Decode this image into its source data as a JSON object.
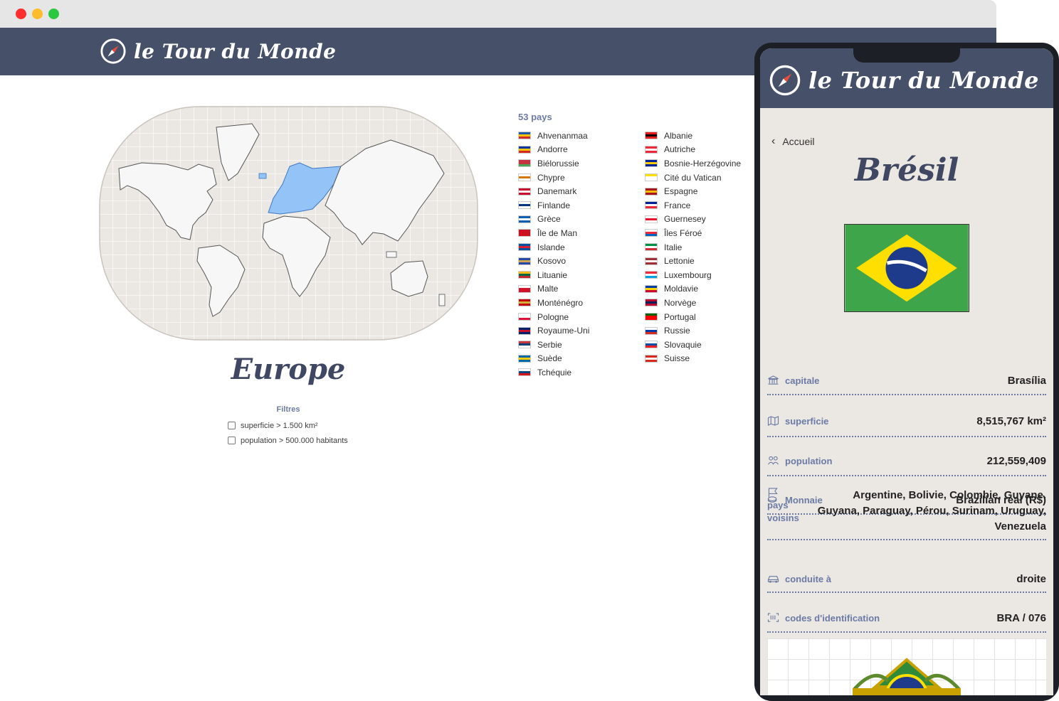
{
  "desktop": {
    "window_dots": [
      "#fe2e2e",
      "#fdbc2c",
      "#29c840"
    ],
    "logo_text": "le Tour du Monde",
    "region_title": "Europe",
    "filters": {
      "title": "Filtres",
      "items": [
        {
          "label": "superficie > 1.500 km²",
          "checked": false
        },
        {
          "label": "population > 500.000 habitants",
          "checked": false
        }
      ]
    },
    "country_count": "53 pays",
    "countries_left": [
      {
        "name": "Ahvenanmaa",
        "flag": [
          "#1f5aa6",
          "#f2c500",
          "#d12d2d"
        ]
      },
      {
        "name": "Andorre",
        "flag": [
          "#10379c",
          "#f2c500",
          "#d52b1e"
        ]
      },
      {
        "name": "Biélorussie",
        "flag": [
          "#c8313e",
          "#c8313e",
          "#4aa657"
        ]
      },
      {
        "name": "Chypre",
        "flag": [
          "#ffffff",
          "#d57800",
          "#ffffff"
        ]
      },
      {
        "name": "Danemark",
        "flag": [
          "#c8102e",
          "#ffffff",
          "#c8102e"
        ]
      },
      {
        "name": "Finlande",
        "flag": [
          "#ffffff",
          "#003580",
          "#ffffff"
        ]
      },
      {
        "name": "Grèce",
        "flag": [
          "#0d5eaf",
          "#ffffff",
          "#0d5eaf"
        ]
      },
      {
        "name": "Île de Man",
        "flag": [
          "#cf1020",
          "#cf1020",
          "#cf1020"
        ]
      },
      {
        "name": "Islande",
        "flag": [
          "#02529c",
          "#dc1e35",
          "#02529c"
        ]
      },
      {
        "name": "Kosovo",
        "flag": [
          "#244aa5",
          "#d0a650",
          "#244aa5"
        ]
      },
      {
        "name": "Lituanie",
        "flag": [
          "#fdb913",
          "#006a44",
          "#c1272d"
        ]
      },
      {
        "name": "Malte",
        "flag": [
          "#ffffff",
          "#cf142b",
          "#cf142b"
        ]
      },
      {
        "name": "Monténégro",
        "flag": [
          "#c40308",
          "#d4af3a",
          "#c40308"
        ]
      },
      {
        "name": "Pologne",
        "flag": [
          "#ffffff",
          "#ffffff",
          "#dc143c"
        ]
      },
      {
        "name": "Royaume-Uni",
        "flag": [
          "#012169",
          "#c8102e",
          "#012169"
        ]
      },
      {
        "name": "Serbie",
        "flag": [
          "#c6363c",
          "#0c4076",
          "#ffffff"
        ]
      },
      {
        "name": "Suède",
        "flag": [
          "#006aa7",
          "#fecc00",
          "#006aa7"
        ]
      },
      {
        "name": "Tchéquie",
        "flag": [
          "#ffffff",
          "#11457e",
          "#d7141a"
        ]
      }
    ],
    "countries_right": [
      {
        "name": "Albanie",
        "flag": [
          "#e41e20",
          "#000000",
          "#e41e20"
        ]
      },
      {
        "name": "Autriche",
        "flag": [
          "#ed2939",
          "#ffffff",
          "#ed2939"
        ]
      },
      {
        "name": "Bosnie-Herzégovine",
        "flag": [
          "#002395",
          "#fecb00",
          "#002395"
        ]
      },
      {
        "name": "Cité du Vatican",
        "flag": [
          "#ffe000",
          "#ffffff",
          "#ffffff"
        ]
      },
      {
        "name": "Espagne",
        "flag": [
          "#aa151b",
          "#f1bf00",
          "#aa151b"
        ]
      },
      {
        "name": "France",
        "flag": [
          "#002395",
          "#ffffff",
          "#ed2939"
        ]
      },
      {
        "name": "Guernesey",
        "flag": [
          "#ffffff",
          "#e8112d",
          "#ffffff"
        ]
      },
      {
        "name": "Îles Féroé",
        "flag": [
          "#ffffff",
          "#ed2939",
          "#0065bd"
        ]
      },
      {
        "name": "Italie",
        "flag": [
          "#009246",
          "#ffffff",
          "#ce2b37"
        ]
      },
      {
        "name": "Lettonie",
        "flag": [
          "#9e3039",
          "#ffffff",
          "#9e3039"
        ]
      },
      {
        "name": "Luxembourg",
        "flag": [
          "#ed2939",
          "#ffffff",
          "#00a1de"
        ]
      },
      {
        "name": "Moldavie",
        "flag": [
          "#003da5",
          "#ffd200",
          "#cc092f"
        ]
      },
      {
        "name": "Norvège",
        "flag": [
          "#ba0c2f",
          "#00205b",
          "#ba0c2f"
        ]
      },
      {
        "name": "Portugal",
        "flag": [
          "#006600",
          "#ff0000",
          "#ff0000"
        ]
      },
      {
        "name": "Russie",
        "flag": [
          "#ffffff",
          "#0039a6",
          "#d52b1e"
        ]
      },
      {
        "name": "Slovaquie",
        "flag": [
          "#ffffff",
          "#0b4ea2",
          "#ee1c25"
        ]
      },
      {
        "name": "Suisse",
        "flag": [
          "#d52b1e",
          "#ffffff",
          "#d52b1e"
        ]
      }
    ]
  },
  "mobile": {
    "logo_text": "le Tour du Monde",
    "back_label": "Accueil",
    "country_name": "Brésil",
    "facts": [
      {
        "icon": "museum-icon",
        "label": "capitale",
        "value": "Brasília"
      },
      {
        "icon": "map-icon",
        "label": "superficie",
        "value": "8,515,767 km²"
      },
      {
        "icon": "people-icon",
        "label": "population",
        "value": "212,559,409"
      },
      {
        "icon": "coins-icon",
        "label": "Monnaie",
        "value": "Brazilian real (R$)"
      },
      {
        "icon": "flag-icon",
        "label": "pays voisins",
        "value": "Argentine, Bolivie, Colombie, Guyane, Guyana, Paraguay, Pérou, Surinam, Uruguay, Venezuela"
      },
      {
        "icon": "car-icon",
        "label": "conduite à",
        "value": "droite"
      },
      {
        "icon": "barcode-icon",
        "label": "codes d'identification",
        "value": "BRA / 076"
      }
    ]
  },
  "colors": {
    "header": "#475069",
    "accent": "#6b7ba6",
    "map_highlight": "#93c3f7",
    "map_bg": "#ebe7e2"
  }
}
